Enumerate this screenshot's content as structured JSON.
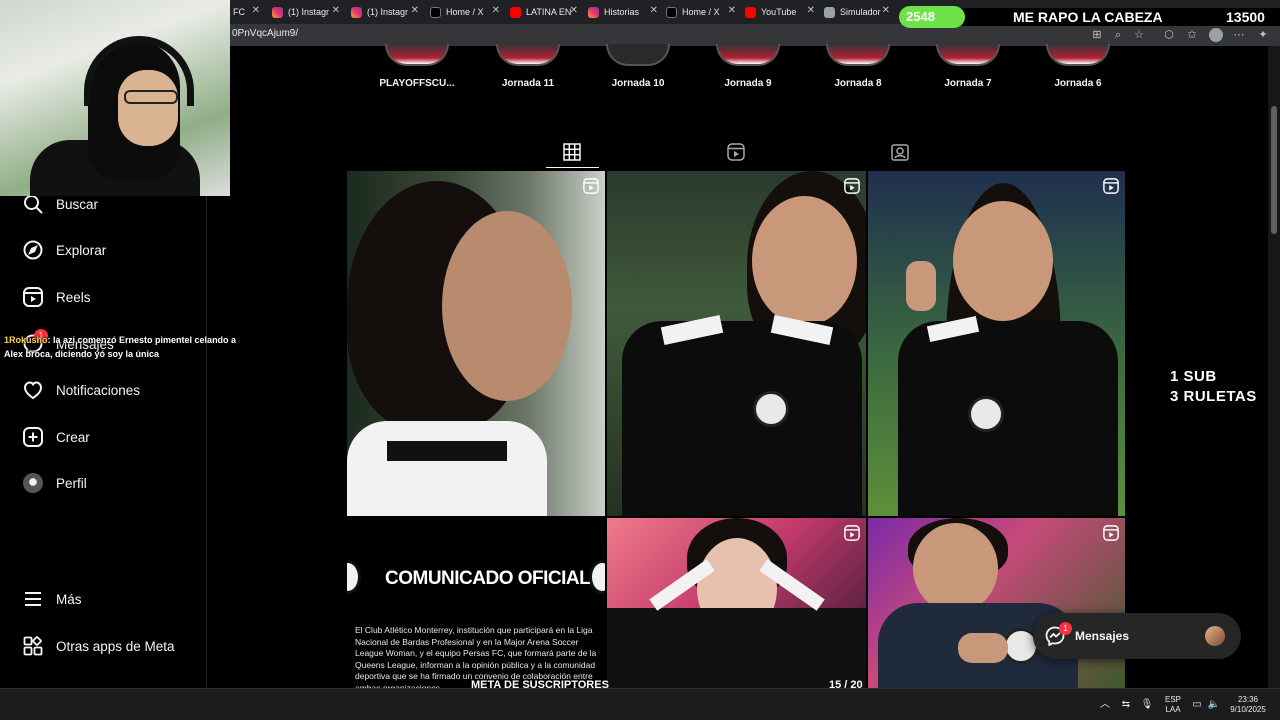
{
  "browser": {
    "tabs": [
      {
        "title": "s FC",
        "icon": "generic-icon"
      },
      {
        "title": "(1) Instagr",
        "icon": "instagram-icon"
      },
      {
        "title": "(1) Instagr",
        "icon": "instagram-icon"
      },
      {
        "title": "Home / X",
        "icon": "x-icon"
      },
      {
        "title": "LATINA EN",
        "icon": "youtube-icon"
      },
      {
        "title": "Historias",
        "icon": "instagram-icon"
      },
      {
        "title": "Home / X",
        "icon": "x-icon"
      },
      {
        "title": "YouTube",
        "icon": "youtube-icon"
      },
      {
        "title": "Simulador",
        "icon": "simulator-icon"
      }
    ],
    "url": "0PnVqcAjum9/"
  },
  "stream": {
    "goal_current": "2548",
    "goal_title": "ME RAPO LA CABEZA",
    "goal_target": "13500",
    "promo_line1": "1 SUB",
    "promo_line2": "3 RULETAS",
    "chat_user": "1Rokusho",
    "chat_text": ": la azi comenzó Ernesto pimentel celando a Alex broca, diciendo yó soy la única",
    "sub_goal_label": "META DE SUSCRIPTORES",
    "sub_goal_count": "15 / 20",
    "sub_goal_progress": 0.75
  },
  "sidebar": {
    "items": [
      {
        "label": "Buscar",
        "icon": "search-icon"
      },
      {
        "label": "Explorar",
        "icon": "compass-icon"
      },
      {
        "label": "Reels",
        "icon": "reels-icon"
      },
      {
        "label": "Mensajes",
        "icon": "messenger-icon",
        "badge": "1"
      },
      {
        "label": "Notificaciones",
        "icon": "heart-icon"
      },
      {
        "label": "Crear",
        "icon": "plus-square-icon"
      },
      {
        "label": "Perfil",
        "icon": "avatar"
      },
      {
        "label": "Más",
        "icon": "menu-icon"
      },
      {
        "label": "Otras apps de Meta",
        "icon": "apps-icon"
      }
    ]
  },
  "highlights": [
    {
      "label": "PLAYOFFSCU..."
    },
    {
      "label": "Jornada 11"
    },
    {
      "label": "Jornada 10"
    },
    {
      "label": "Jornada 9"
    },
    {
      "label": "Jornada 8"
    },
    {
      "label": "Jornada 7"
    },
    {
      "label": "Jornada 6"
    }
  ],
  "profile_tabs": [
    {
      "name": "posts",
      "icon": "grid-icon",
      "active": true
    },
    {
      "name": "reels",
      "icon": "reels-icon",
      "active": false
    },
    {
      "name": "tagged",
      "icon": "tagged-icon",
      "active": false
    }
  ],
  "posts": {
    "comunicado_title": "COMUNICADO OFICIAL",
    "comunicado_body": "El Club Atlético Monterrey, institución que participará en la Liga Nacional de Bardas Profesional y en la Major Arena Soccer League Woman, y el equipo Persas FC, que formará parte de la Queens League, informan a la opinión pública y a la comunidad deportiva que se ha firmado un convenio de colaboración entre ambas organizaciones."
  },
  "messages_pill": {
    "label": "Mensajes",
    "badge": "1"
  },
  "taskbar": {
    "lang_top": "ESP",
    "lang_bottom": "LAA",
    "time": "23:36",
    "date": "9/10/2025"
  },
  "colors": {
    "goal_green": "#6fe24a",
    "sub_bar_border": "#3fd86a",
    "badge_red": "#ff3040",
    "chat_user": "#f7d34a"
  }
}
